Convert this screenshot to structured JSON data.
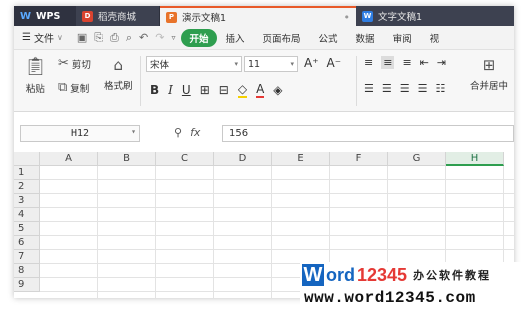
{
  "tabs": [
    {
      "label": "WPS",
      "icon": "wps-logo-icon"
    },
    {
      "label": "稻壳商城",
      "icon": "daoke-store-icon"
    },
    {
      "label": "演示文稿1",
      "icon": "presentation-icon"
    },
    {
      "label": "文字文稿1",
      "icon": "writer-doc-icon"
    }
  ],
  "menubar": {
    "file": "文件",
    "items": [
      "开始",
      "插入",
      "页面布局",
      "公式",
      "数据",
      "审阅",
      "视"
    ]
  },
  "ribbon": {
    "paste": "粘贴",
    "cut": "剪切",
    "copy": "复制",
    "format_painter": "格式刷",
    "font_name": "宋体",
    "font_size": "11",
    "merge_center": "合并居中"
  },
  "formula": {
    "name_box": "H12",
    "fx": "fx",
    "value": "156"
  },
  "grid": {
    "columns": [
      "A",
      "B",
      "C",
      "D",
      "E",
      "F",
      "G",
      "H"
    ],
    "selected_column": "H",
    "rows": [
      "1",
      "2",
      "3",
      "4",
      "5",
      "6",
      "7",
      "8",
      "9"
    ]
  },
  "watermark": {
    "w": "W",
    "ord": "ord",
    "num": "12345",
    "cn": "办公软件教程",
    "url": "www.word12345.com"
  },
  "colors": {
    "accent_green": "#2e9e4f",
    "tabbar": "#3d4150",
    "watermark_blue": "#1565c0",
    "watermark_red": "#e53935"
  }
}
